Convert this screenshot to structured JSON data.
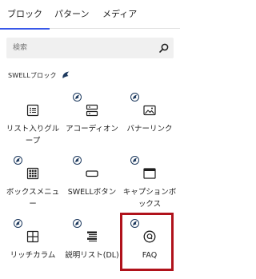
{
  "tabs": [
    {
      "label": "ブロック",
      "active": true
    },
    {
      "label": "パターン",
      "active": false
    },
    {
      "label": "メディア",
      "active": false
    }
  ],
  "search": {
    "placeholder": "検索"
  },
  "category": {
    "label": "SWELLブロック"
  },
  "blocks": [
    {
      "label": "リスト入りグループ",
      "icon": "list-icon",
      "badge": false
    },
    {
      "label": "アコーディオン",
      "icon": "accordion-icon",
      "badge": true
    },
    {
      "label": "バナーリンク",
      "icon": "image-icon",
      "badge": true
    },
    {
      "label": "ボックスメニュー",
      "icon": "grid-icon",
      "badge": true
    },
    {
      "label": "SWELLボタン",
      "icon": "button-icon",
      "badge": true
    },
    {
      "label": "キャプションボックス",
      "icon": "window-icon",
      "badge": true
    },
    {
      "label": "リッチカラム",
      "icon": "columns-icon",
      "badge": true
    },
    {
      "label": "説明リスト(DL)",
      "icon": "description-list-icon",
      "badge": true
    },
    {
      "label": "FAQ",
      "icon": "faq-icon",
      "badge": true,
      "highlighted": true
    }
  ],
  "colors": {
    "accent": "#3858e9",
    "highlight": "#b0121b",
    "badge": "#1e3a5f"
  }
}
